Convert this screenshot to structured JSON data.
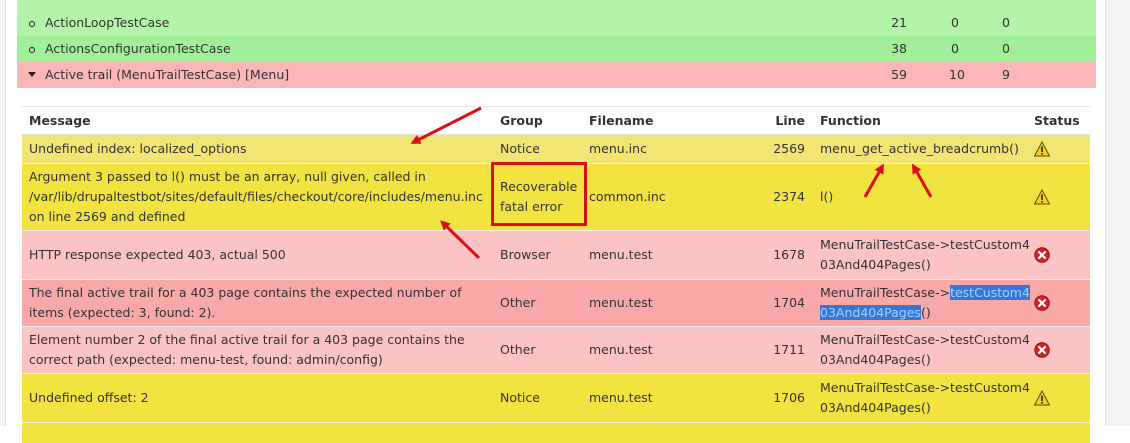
{
  "summary": [
    {
      "name": "ActionLoopTestCase",
      "pass": "21",
      "fail": "0",
      "exceptions": "0",
      "color": "#b4f4a8",
      "icon": "bullet"
    },
    {
      "name": "ActionsConfigurationTestCase",
      "pass": "38",
      "fail": "0",
      "exceptions": "0",
      "color": "#a2ef9a",
      "icon": "bullet"
    },
    {
      "name": "Active trail (MenuTrailTestCase) [Menu]",
      "pass": "59",
      "fail": "10",
      "exceptions": "9",
      "color": "#fbb7b7",
      "icon": "collapse-triangle"
    }
  ],
  "columns": {
    "message": "Message",
    "group": "Group",
    "filename": "Filename",
    "line": "Line",
    "function": "Function",
    "status": "Status"
  },
  "rows": [
    {
      "message": "Undefined index: localized_options",
      "group": "Notice",
      "filename": "menu.inc",
      "line": "2569",
      "function": "menu_get_active_breadcrumb()",
      "function_highlight": "",
      "function_tail": "",
      "status": "warning",
      "color": "#f1e574"
    },
    {
      "message": "Argument 3 passed to l() must be an array, null given, called in /var/lib/drupaltestbot/sites/default/files/checkout/core/includes/menu.inc on line 2569 and defined",
      "group": "Recoverable fatal error",
      "filename": "common.inc",
      "line": "2374",
      "function": "l()",
      "function_highlight": "",
      "function_tail": "",
      "status": "warning",
      "color": "#f1e440"
    },
    {
      "message": "HTTP response expected 403, actual 500",
      "group": "Browser",
      "filename": "menu.test",
      "line": "1678",
      "function": "MenuTrailTestCase->testCustom403And404Pages()",
      "function_highlight": "",
      "function_tail": "",
      "status": "error",
      "color": "#fbc3c3"
    },
    {
      "message": "The final active trail for a 403 page contains the expected number of items (expected: 3, found: 2).",
      "group": "Other",
      "filename": "menu.test",
      "line": "1704",
      "function": "MenuTrailTestCase->",
      "function_highlight": "testCustom403And404Pages",
      "function_tail": "()",
      "status": "error",
      "color": "#f9a8a8"
    },
    {
      "message": "Element number 2 of the final active trail for a 403 page contains the correct path (expected: menu-test, found: admin/config)",
      "group": "Other",
      "filename": "menu.test",
      "line": "1711",
      "function": "MenuTrailTestCase->testCustom403And404Pages()",
      "function_highlight": "",
      "function_tail": "",
      "status": "error",
      "color": "#fbc3c3"
    },
    {
      "message": "Undefined offset: 2",
      "group": "Notice",
      "filename": "menu.test",
      "line": "1706",
      "function": "MenuTrailTestCase->testCustom403And404Pages()",
      "function_highlight": "",
      "function_tail": "",
      "status": "warning",
      "color": "#f1e440"
    }
  ],
  "annotation_color": "#d8101a"
}
